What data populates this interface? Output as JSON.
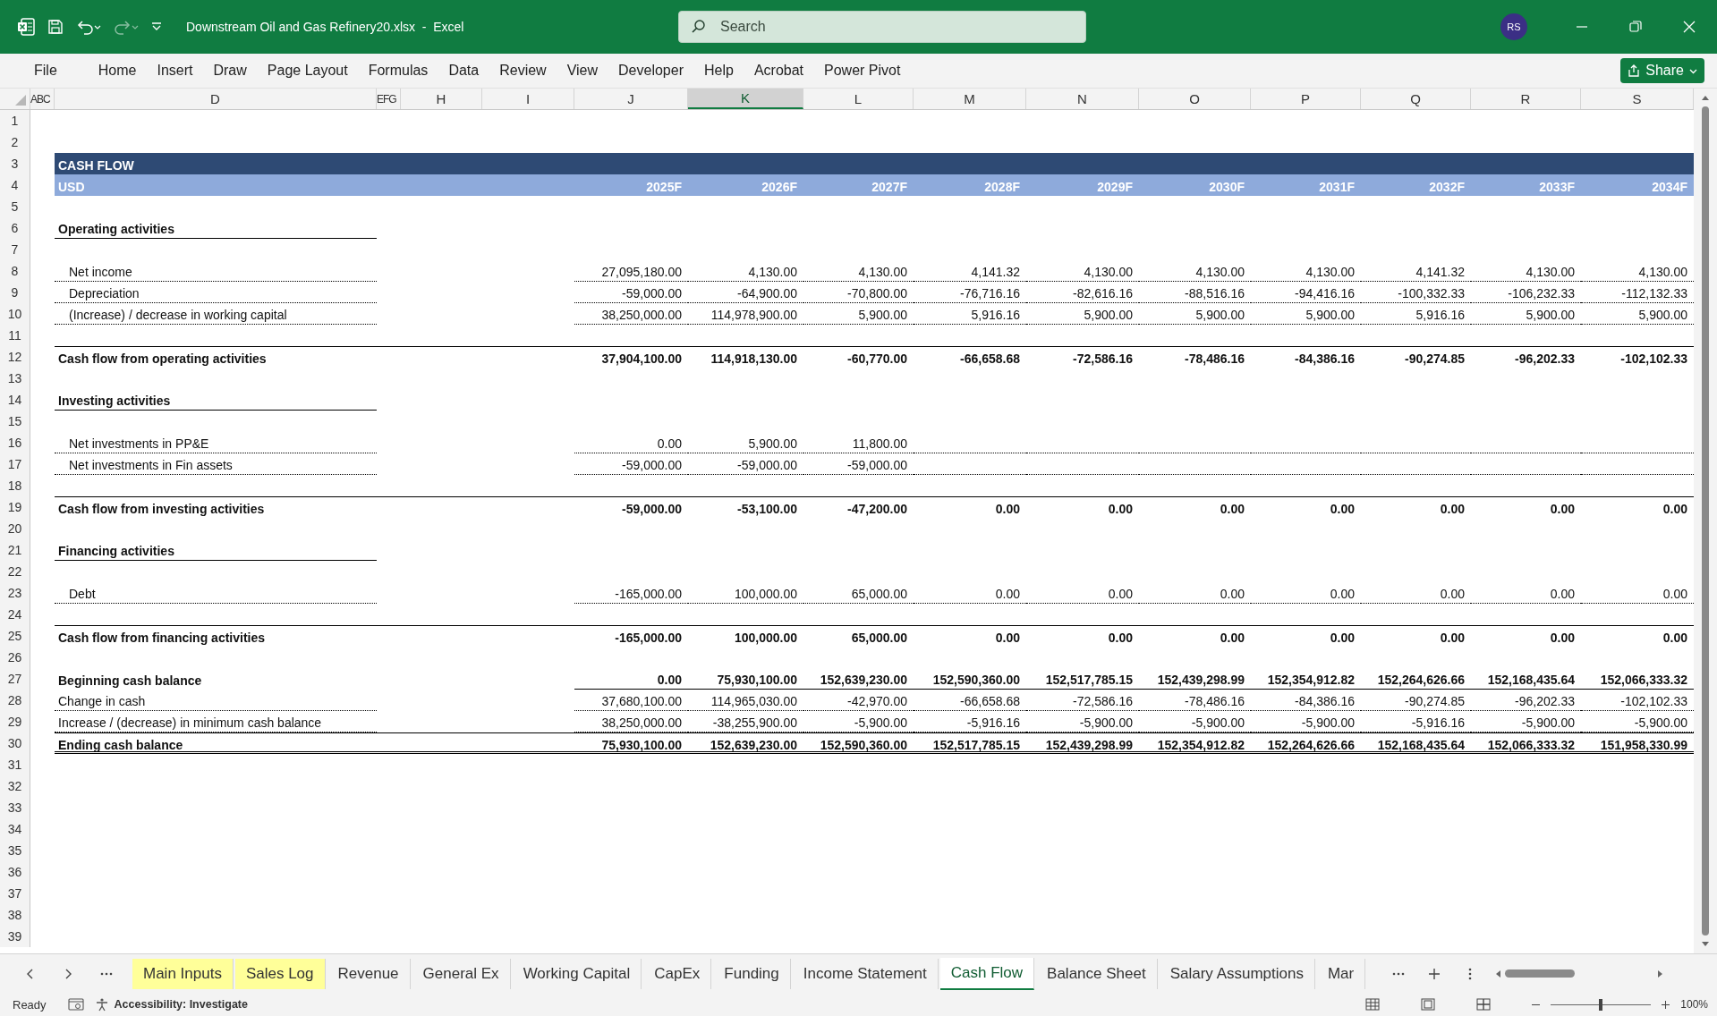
{
  "window": {
    "title": "Downstream Oil and Gas Refinery20.xlsx  -  Excel",
    "search": {
      "placeholder": "Search"
    },
    "avatar": "RS"
  },
  "menu": [
    "File",
    "Home",
    "Insert",
    "Draw",
    "Page Layout",
    "Formulas",
    "Data",
    "Review",
    "View",
    "Developer",
    "Help",
    "Acrobat",
    "Power Pivot"
  ],
  "share": "Share",
  "columns": [
    {
      "label": "A",
      "selected": false
    },
    {
      "label": "B",
      "selected": false
    },
    {
      "label": "C",
      "selected": false
    },
    {
      "label": "D",
      "selected": false
    },
    {
      "label": "E",
      "selected": false
    },
    {
      "label": "F",
      "selected": false
    },
    {
      "label": "G",
      "selected": false
    },
    {
      "label": "H",
      "selected": false
    },
    {
      "label": "I",
      "selected": false
    },
    {
      "label": "J",
      "selected": false
    },
    {
      "label": "K",
      "selected": true
    },
    {
      "label": "L",
      "selected": false
    },
    {
      "label": "M",
      "selected": false
    },
    {
      "label": "N",
      "selected": false
    },
    {
      "label": "O",
      "selected": false
    },
    {
      "label": "P",
      "selected": false
    },
    {
      "label": "Q",
      "selected": false
    },
    {
      "label": "R",
      "selected": false
    },
    {
      "label": "S",
      "selected": false
    }
  ],
  "rows": [
    {
      "num": "1",
      "kind": "empty"
    },
    {
      "num": "2",
      "kind": "empty"
    },
    {
      "num": "3",
      "kind": "title",
      "label": "CASH FLOW"
    },
    {
      "num": "4",
      "kind": "header",
      "label": "USD",
      "values": [
        "2025F",
        "2026F",
        "2027F",
        "2028F",
        "2029F",
        "2030F",
        "2031F",
        "2032F",
        "2033F",
        "2034F"
      ]
    },
    {
      "num": "5",
      "kind": "empty"
    },
    {
      "num": "6",
      "kind": "section",
      "label": "Operating activities"
    },
    {
      "num": "7",
      "kind": "empty"
    },
    {
      "num": "8",
      "kind": "item",
      "label": "Net income",
      "values": [
        "27,095,180.00",
        "4,130.00",
        "4,130.00",
        "4,141.32",
        "4,130.00",
        "4,130.00",
        "4,130.00",
        "4,141.32",
        "4,130.00",
        "4,130.00"
      ]
    },
    {
      "num": "9",
      "kind": "item",
      "label": "Depreciation",
      "values": [
        "-59,000.00",
        "-64,900.00",
        "-70,800.00",
        "-76,716.16",
        "-82,616.16",
        "-88,516.16",
        "-94,416.16",
        "-100,332.33",
        "-106,232.33",
        "-112,132.33"
      ]
    },
    {
      "num": "10",
      "kind": "item",
      "label": "(Increase) / decrease in working capital",
      "values": [
        "38,250,000.00",
        "114,978,900.00",
        "5,900.00",
        "5,916.16",
        "5,900.00",
        "5,900.00",
        "5,900.00",
        "5,916.16",
        "5,900.00",
        "5,900.00"
      ]
    },
    {
      "num": "11",
      "kind": "empty"
    },
    {
      "num": "12",
      "kind": "total",
      "label": "Cash flow from operating activities",
      "values": [
        "37,904,100.00",
        "114,918,130.00",
        "-60,770.00",
        "-66,658.68",
        "-72,586.16",
        "-78,486.16",
        "-84,386.16",
        "-90,274.85",
        "-96,202.33",
        "-102,102.33"
      ]
    },
    {
      "num": "13",
      "kind": "empty"
    },
    {
      "num": "14",
      "kind": "section",
      "label": "Investing activities"
    },
    {
      "num": "15",
      "kind": "empty"
    },
    {
      "num": "16",
      "kind": "item",
      "label": "Net investments in PP&E",
      "values": [
        "0.00",
        "5,900.00",
        "11,800.00"
      ]
    },
    {
      "num": "17",
      "kind": "item",
      "label": "Net investments in Fin assets",
      "values": [
        "-59,000.00",
        "-59,000.00",
        "-59,000.00"
      ]
    },
    {
      "num": "18",
      "kind": "empty"
    },
    {
      "num": "19",
      "kind": "total",
      "label": "Cash flow from investing activities",
      "values": [
        "-59,000.00",
        "-53,100.00",
        "-47,200.00",
        "0.00",
        "0.00",
        "0.00",
        "0.00",
        "0.00",
        "0.00",
        "0.00"
      ]
    },
    {
      "num": "20",
      "kind": "empty"
    },
    {
      "num": "21",
      "kind": "section",
      "label": "Financing activities"
    },
    {
      "num": "22",
      "kind": "empty"
    },
    {
      "num": "23",
      "kind": "item",
      "label": "Debt",
      "values": [
        "-165,000.00",
        "100,000.00",
        "65,000.00",
        "0.00",
        "0.00",
        "0.00",
        "0.00",
        "0.00",
        "0.00",
        "0.00"
      ]
    },
    {
      "num": "24",
      "kind": "empty"
    },
    {
      "num": "25",
      "kind": "total",
      "label": "Cash flow from financing activities",
      "values": [
        "-165,000.00",
        "100,000.00",
        "65,000.00",
        "0.00",
        "0.00",
        "0.00",
        "0.00",
        "0.00",
        "0.00",
        "0.00"
      ]
    },
    {
      "num": "26",
      "kind": "empty"
    },
    {
      "num": "27",
      "kind": "opening",
      "label": "Beginning cash balance",
      "values": [
        "0.00",
        "75,930,100.00",
        "152,639,230.00",
        "152,590,360.00",
        "152,517,785.15",
        "152,439,298.99",
        "152,354,912.82",
        "152,264,626.66",
        "152,168,435.64",
        "152,066,333.32"
      ]
    },
    {
      "num": "28",
      "kind": "detail",
      "label": "Change in cash",
      "values": [
        "37,680,100.00",
        "114,965,030.00",
        "-42,970.00",
        "-66,658.68",
        "-72,586.16",
        "-78,486.16",
        "-84,386.16",
        "-90,274.85",
        "-96,202.33",
        "-102,102.33"
      ]
    },
    {
      "num": "29",
      "kind": "detail",
      "label": "Increase / (decrease) in minimum cash balance",
      "values": [
        "38,250,000.00",
        "-38,255,900.00",
        "-5,900.00",
        "-5,916.16",
        "-5,900.00",
        "-5,900.00",
        "-5,900.00",
        "-5,916.16",
        "-5,900.00",
        "-5,900.00"
      ]
    },
    {
      "num": "30",
      "kind": "ending",
      "label": "Ending cash balance",
      "values": [
        "75,930,100.00",
        "152,639,230.00",
        "152,590,360.00",
        "152,517,785.15",
        "152,439,298.99",
        "152,354,912.82",
        "152,264,626.66",
        "152,168,435.64",
        "152,066,333.32",
        "151,958,330.99"
      ]
    },
    {
      "num": "31",
      "kind": "empty"
    },
    {
      "num": "32",
      "kind": "empty"
    },
    {
      "num": "33",
      "kind": "empty"
    },
    {
      "num": "34",
      "kind": "empty"
    },
    {
      "num": "35",
      "kind": "empty"
    },
    {
      "num": "36",
      "kind": "empty"
    },
    {
      "num": "37",
      "kind": "empty"
    },
    {
      "num": "38",
      "kind": "empty"
    },
    {
      "num": "39",
      "kind": "empty"
    }
  ],
  "sheet_tabs": [
    {
      "label": "Main Inputs",
      "selected": false,
      "color": "#ffff99"
    },
    {
      "label": "Sales Log",
      "selected": false,
      "color": "#ffff99"
    },
    {
      "label": "Revenue",
      "selected": false
    },
    {
      "label": "General Ex",
      "selected": false
    },
    {
      "label": "Working Capital",
      "selected": false
    },
    {
      "label": "CapEx",
      "selected": false
    },
    {
      "label": "Funding",
      "selected": false
    },
    {
      "label": "Income Statement",
      "selected": false
    },
    {
      "label": "Cash Flow",
      "selected": true
    },
    {
      "label": "Balance Sheet",
      "selected": false
    },
    {
      "label": "Salary Assumptions",
      "selected": false
    },
    {
      "label": "Mar",
      "selected": false
    }
  ],
  "status_bar": {
    "mode": "Ready",
    "accessibility": "Accessibility: Investigate",
    "zoom": "100%",
    "zoom_slider": {
      "level": 0.5
    }
  }
}
